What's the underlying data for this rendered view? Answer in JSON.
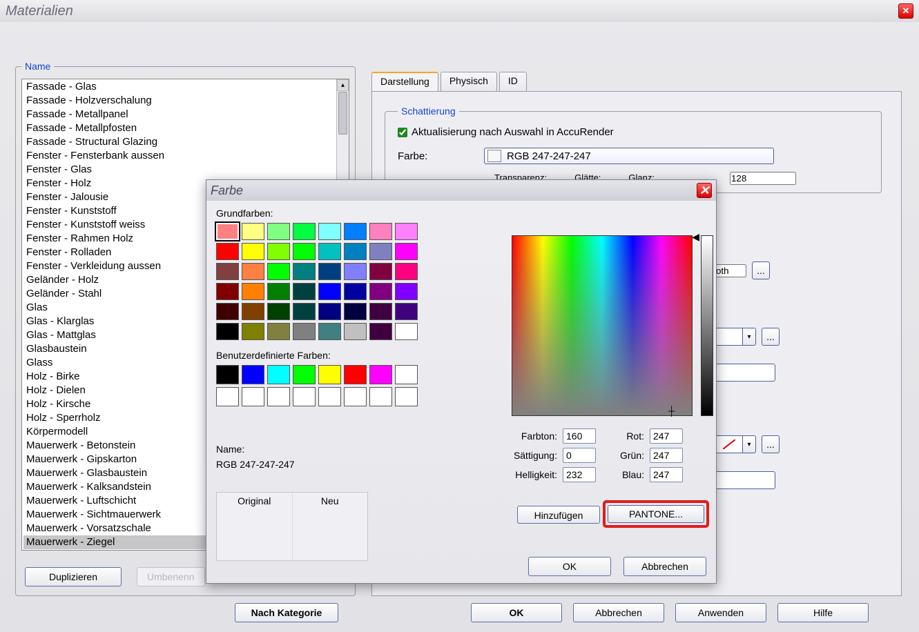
{
  "main": {
    "title": "Materialien",
    "group_name_label": "Name",
    "materials": [
      "Fassade - Glas",
      "Fassade - Holzverschalung",
      "Fassade - Metallpanel",
      "Fassade - Metallpfosten",
      "Fassade - Structural Glazing",
      "Fenster - Fensterbank aussen",
      "Fenster - Glas",
      "Fenster - Holz",
      "Fenster - Jalousie",
      "Fenster - Kunststoff",
      "Fenster - Kunststoff weiss",
      "Fenster - Rahmen Holz",
      "Fenster - Rolladen",
      "Fenster - Verkleidung aussen",
      "Geländer - Holz",
      "Geländer - Stahl",
      "Glas",
      "Glas - Klarglas",
      "Glas - Mattglas",
      "Glasbaustein",
      "Glass",
      "Holz - Birke",
      "Holz - Dielen",
      "Holz - Kirsche",
      "Holz - Sperrholz",
      "Körpermodell",
      "Mauerwerk - Betonstein",
      "Mauerwerk - Gipskarton",
      "Mauerwerk - Glasbaustein",
      "Mauerwerk - Kalksandstein",
      "Mauerwerk - Luftschicht",
      "Mauerwerk - Sichtmauerwerk",
      "Mauerwerk - Vorsatzschale",
      "Mauerwerk - Ziegel"
    ],
    "selected_index": 33,
    "btn_duplicate": "Duplizieren",
    "btn_rename": "Umbenenn",
    "tabs": [
      "Darstellung",
      "Physisch",
      "ID"
    ],
    "active_tab": 0,
    "shading_label": "Schattierung",
    "chk_accurender": "Aktualisierung nach Auswahl in AccuRender",
    "color_label": "Farbe:",
    "color_value_text": "RGB 247-247-247",
    "transparenz": "Transparenz:",
    "glaette": "Glätte:",
    "glanz": "Glanz:",
    "glanz_value": "128",
    "aux_value_1": "oth",
    "btn_by_category": "Nach Kategorie",
    "btn_ok": "OK",
    "btn_cancel": "Abbrechen",
    "btn_apply": "Anwenden",
    "btn_help": "Hilfe"
  },
  "farbe": {
    "title": "Farbe",
    "grundfarben_label": "Grundfarben:",
    "grundfarben_colors": [
      "#ff8080",
      "#ffff80",
      "#80ff80",
      "#00ff40",
      "#80ffff",
      "#0080ff",
      "#ff80c0",
      "#ff80ff",
      "#ff0000",
      "#ffff00",
      "#80ff00",
      "#00ff00",
      "#00c0c0",
      "#0080c0",
      "#8080c0",
      "#ff00ff",
      "#804040",
      "#ff8040",
      "#00ff00",
      "#008080",
      "#004080",
      "#8080ff",
      "#800040",
      "#ff0080",
      "#800000",
      "#ff8000",
      "#008000",
      "#004040",
      "#0000ff",
      "#0000a0",
      "#800080",
      "#8000ff",
      "#400000",
      "#804000",
      "#004000",
      "#004040",
      "#000080",
      "#000040",
      "#400040",
      "#400080",
      "#000000",
      "#808000",
      "#808040",
      "#808080",
      "#408080",
      "#c0c0c0",
      "#400040",
      "#ffffff"
    ],
    "benutzer_label": "Benutzerdefinierte Farben:",
    "benutzer_colors": [
      "#000000",
      "#0000ff",
      "#00ffff",
      "#00ff00",
      "#ffff00",
      "#ff0000",
      "#ff00ff",
      "#ffffff",
      "",
      "",
      "",
      "",
      "",
      "",
      "",
      ""
    ],
    "name_label": "Name:",
    "name_value": "RGB 247-247-247",
    "original_label": "Original",
    "neu_label": "Neu",
    "farbton_label": "Farbton:",
    "farbton": "160",
    "saett_label": "Sättigung:",
    "saett": "0",
    "hell_label": "Helligkeit:",
    "hell": "232",
    "rot_label": "Rot:",
    "rot": "247",
    "gruen_label": "Grün:",
    "gruen": "247",
    "blau_label": "Blau:",
    "blau": "247",
    "btn_add": "Hinzufügen",
    "btn_pantone": "PANTONE...",
    "btn_ok": "OK",
    "btn_cancel": "Abbrechen"
  }
}
